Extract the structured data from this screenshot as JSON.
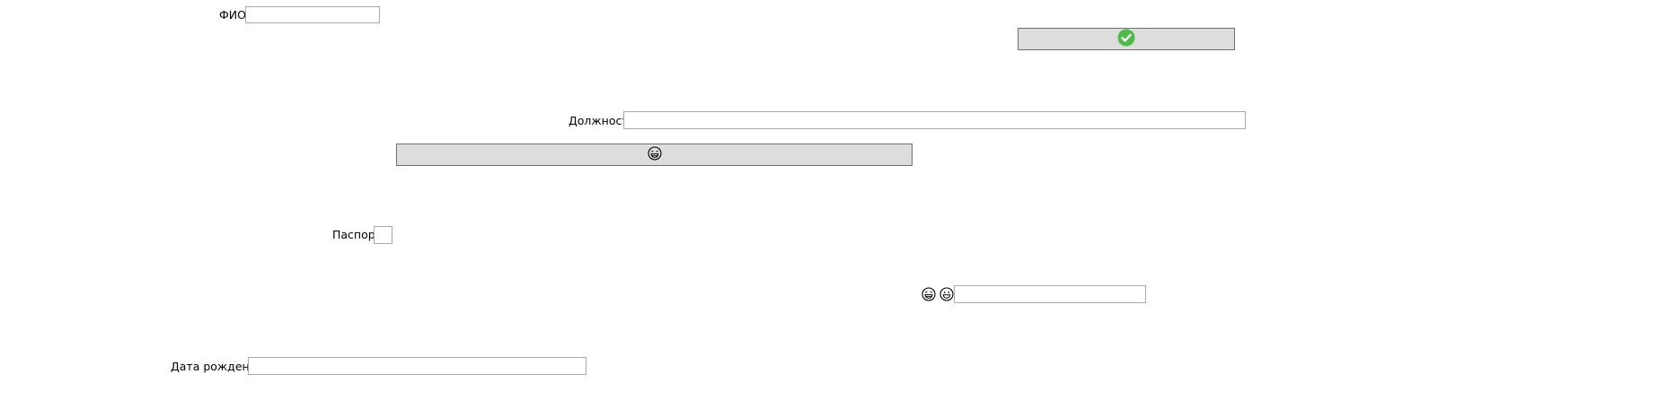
{
  "form": {
    "fio": {
      "label": "ФИО",
      "value": ""
    },
    "position": {
      "label": "Должность",
      "value": ""
    },
    "passport": {
      "label": "Паспорт",
      "value": ""
    },
    "birthdate": {
      "label": "Дата рождения",
      "value": ""
    },
    "emoji_field": {
      "value": ""
    }
  },
  "buttons": {
    "confirm": {
      "icon": "check-circle-icon",
      "color": "#4cbb47"
    },
    "laugh": {
      "icon": "laughing-face-icon"
    }
  },
  "icons": {
    "laughing_face": "laughing-face-icon",
    "grinning_face": "grinning-face-icon"
  }
}
